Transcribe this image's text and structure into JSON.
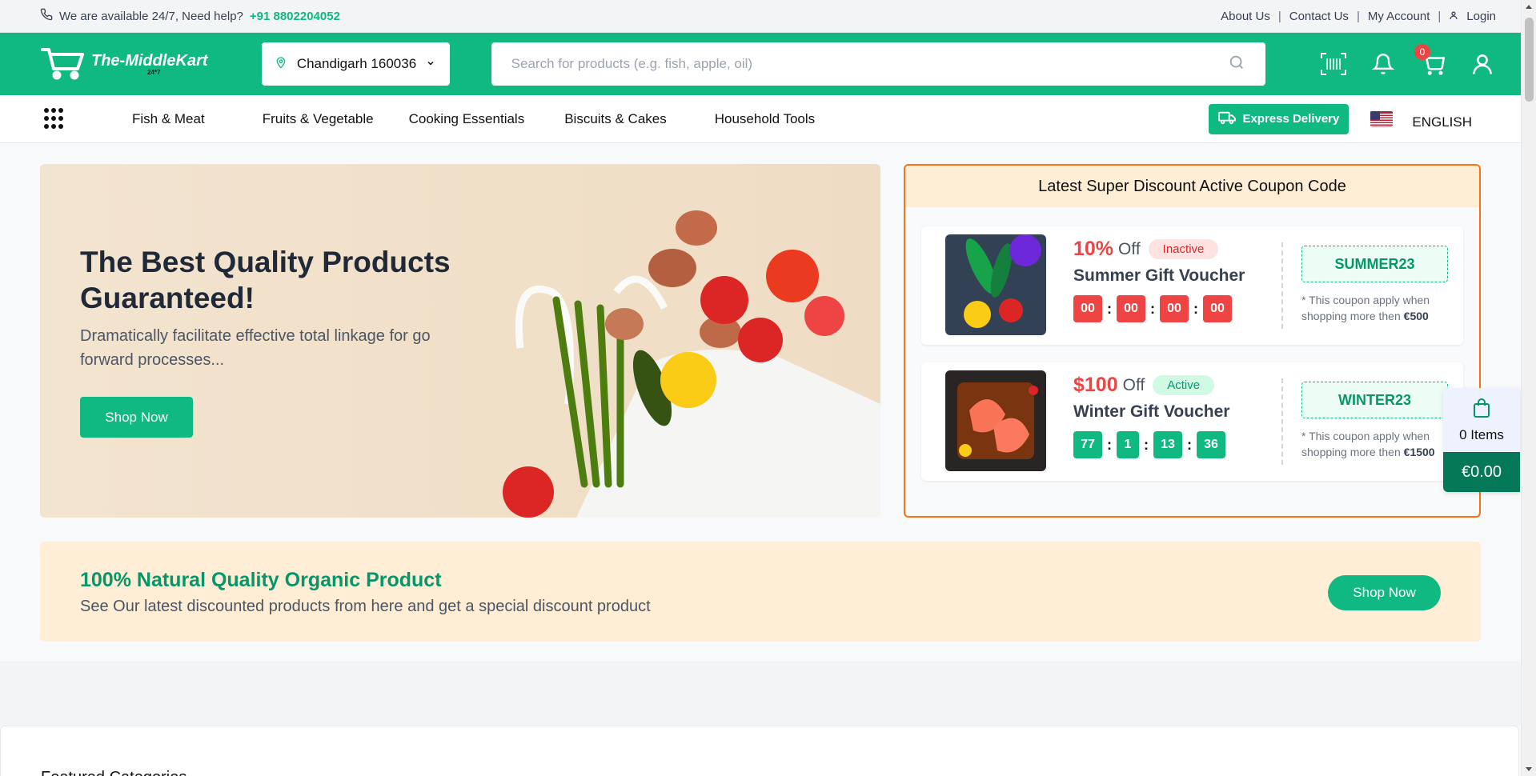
{
  "topbar": {
    "availability": "We are available 24/7, Need help?",
    "phone": "+91 8802204052",
    "links": [
      "About Us",
      "Contact Us",
      "My Account",
      "Login"
    ]
  },
  "header": {
    "logo_text": "The-MiddleKart",
    "logo_sub": "24*7",
    "location": "Chandigarh 160036",
    "search_placeholder": "Search for products (e.g. fish, apple, oil)",
    "cart_count": "0"
  },
  "nav": {
    "items": [
      "Fish & Meat",
      "Fruits & Vegetable",
      "Cooking Essentials",
      "Biscuits & Cakes",
      "Household Tools"
    ],
    "express": "Express Delivery",
    "language": "ENGLISH"
  },
  "hero": {
    "title": "The Best Quality Products Guaranteed!",
    "description": "Dramatically facilitate effective total linkage for go forward processes...",
    "button": "Shop Now"
  },
  "coupons": {
    "heading": "Latest Super Discount Active Coupon Code",
    "items": [
      {
        "amount": "10%",
        "off": "Off",
        "status": "Inactive",
        "name": "Summer Gift Voucher",
        "timer": [
          "00",
          "00",
          "00",
          "00"
        ],
        "code": "SUMMER23",
        "note": "* This coupon apply when shopping more then",
        "min": "€500"
      },
      {
        "amount": "$100",
        "off": "Off",
        "status": "Active",
        "name": "Winter Gift Voucher",
        "timer": [
          "77",
          "1",
          "13",
          "36"
        ],
        "code": "WINTER23",
        "note": "* This coupon apply when shopping more then",
        "min": "€1500"
      }
    ]
  },
  "promo": {
    "title": "100% Natural Quality Organic Product",
    "description": "See Our latest discounted products from here and get a special discount product",
    "button": "Shop Now"
  },
  "featured": {
    "title": "Featured Categories"
  },
  "float_cart": {
    "items": "0 Items",
    "total": "€0.00"
  },
  "colors": {
    "brand": "#10b981",
    "accent": "#f97316",
    "danger": "#ef4444"
  }
}
